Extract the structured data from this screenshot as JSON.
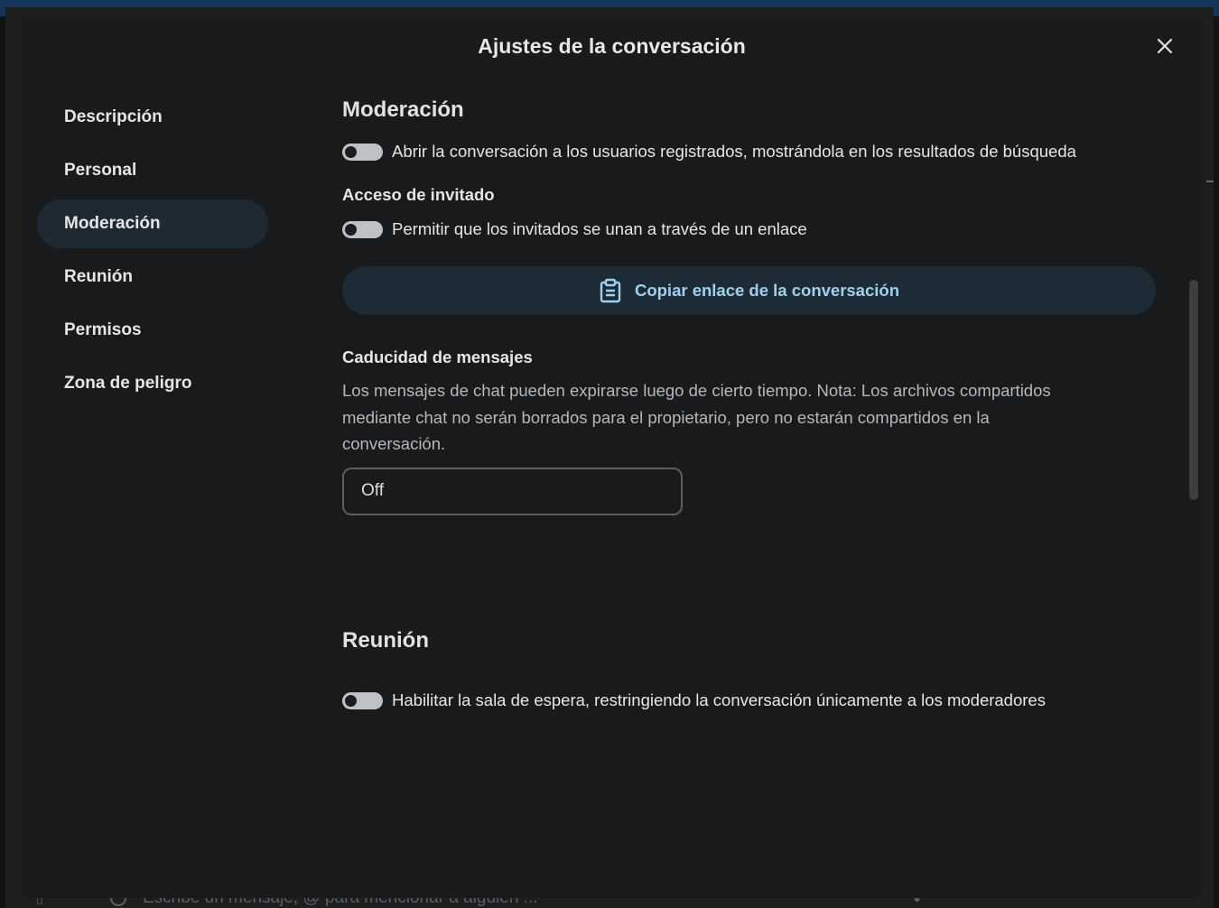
{
  "background": {
    "composer_placeholder": "Escribe un mensaje, @ para mencionar a alguien ..."
  },
  "modal": {
    "title": "Ajustes de la conversación",
    "close_icon": "close-icon"
  },
  "nav": {
    "items": [
      {
        "label": "Descripción"
      },
      {
        "label": "Personal"
      },
      {
        "label": "Moderación"
      },
      {
        "label": "Reunión"
      },
      {
        "label": "Permisos"
      },
      {
        "label": "Zona de peligro"
      }
    ],
    "active": "Moderación"
  },
  "moderation": {
    "title": "Moderación",
    "open_toggle_label": "Abrir la conversación a los usuarios registrados, mostrándola en los resultados de búsqueda",
    "guest_access": {
      "title": "Acceso de invitado",
      "toggle_label": "Permitir que los invitados se unan a través de un enlace"
    },
    "copy_link_label": "Copiar enlace de la conversación",
    "expiration": {
      "title": "Caducidad de mensajes",
      "description": "Los mensajes de chat pueden expirarse luego de cierto tiempo. Nota: Los archivos compartidos mediante chat no serán borrados para el propietario, pero no estarán compartidos en la conversación.",
      "selected": "Off"
    }
  },
  "meeting": {
    "title": "Reunión",
    "lobby_toggle_label": "Habilitar la sala de espera, restringiendo la conversación únicamente a los moderadores"
  },
  "colors": {
    "accent": "#9fd1ee",
    "active_nav_bg": "#1e2a33",
    "modal_bg": "#191a1b"
  }
}
